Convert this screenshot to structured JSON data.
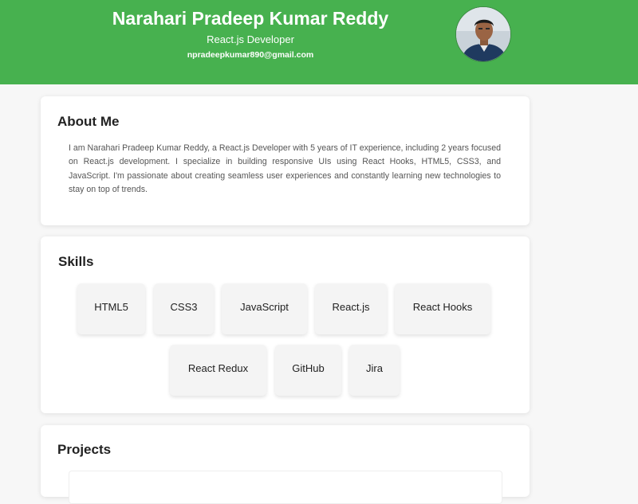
{
  "header": {
    "name": "Narahari Pradeep Kumar Reddy",
    "role": "React.js Developer",
    "email": "npradeepkumar890@gmail.com",
    "background_color": "#47b14f"
  },
  "about": {
    "title": "About Me",
    "text": "I am Narahari Pradeep Kumar Reddy, a React.js Developer with 5 years of IT experience, including 2 years focused on React.js development. I specialize in building responsive UIs using React Hooks, HTML5, CSS3, and JavaScript. I'm passionate about creating seamless user experiences and constantly learning new technologies to stay on top of trends."
  },
  "skills": {
    "title": "Skills",
    "items": [
      "HTML5",
      "CSS3",
      "JavaScript",
      "React.js",
      "React Hooks",
      "React Redux",
      "GitHub",
      "Jira"
    ]
  },
  "projects": {
    "title": "Projects"
  }
}
